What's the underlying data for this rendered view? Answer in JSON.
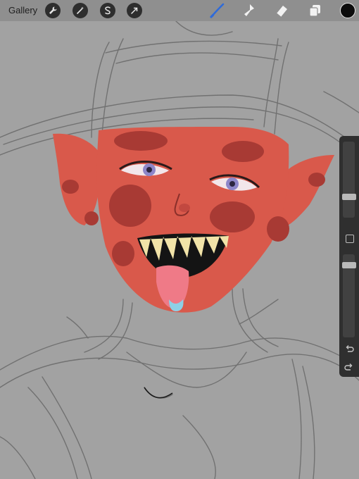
{
  "toolbar": {
    "gallery_label": "Gallery",
    "action_icons": [
      "wrench-icon",
      "magic-wand-icon",
      "selection-icon",
      "transform-arrow-icon"
    ],
    "tools": [
      {
        "name": "brush-icon",
        "active": true
      },
      {
        "name": "smudge-icon",
        "active": false
      },
      {
        "name": "eraser-icon",
        "active": false
      },
      {
        "name": "layers-icon",
        "active": false
      }
    ],
    "active_color": "#0d0d0d",
    "accent": "#2f6bd9"
  },
  "sidebar": {
    "brush_size_level": 0.25,
    "opacity_level": 0.9,
    "icons": [
      "modify-square-icon",
      "undo-icon",
      "redo-icon"
    ]
  },
  "canvas": {
    "background": "#a2a2a2",
    "skin_color": "#d9594b",
    "blush_color": "#a83a34",
    "tongue_color": "#ef7a87"
  }
}
